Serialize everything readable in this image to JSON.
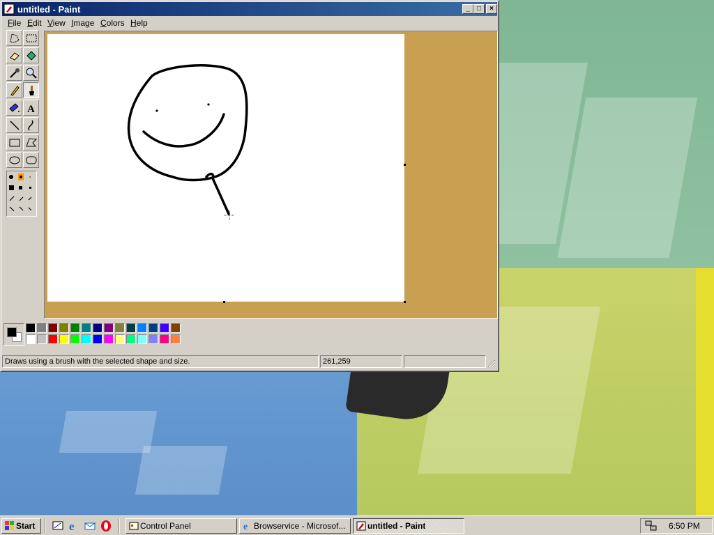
{
  "window": {
    "title": "untitled - Paint",
    "controls": {
      "minimize": "_",
      "maximize": "□",
      "close": "×"
    }
  },
  "menu": [
    {
      "label": "File",
      "accel": "F"
    },
    {
      "label": "Edit",
      "accel": "E"
    },
    {
      "label": "View",
      "accel": "V"
    },
    {
      "label": "Image",
      "accel": "I"
    },
    {
      "label": "Colors",
      "accel": "C"
    },
    {
      "label": "Help",
      "accel": "H"
    }
  ],
  "tools": [
    "free-form-select-icon",
    "select-icon",
    "eraser-icon",
    "fill-icon",
    "pick-color-icon",
    "magnifier-icon",
    "pencil-icon",
    "brush-icon",
    "airbrush-icon",
    "text-icon",
    "line-icon",
    "curve-icon",
    "rectangle-icon",
    "polygon-icon",
    "ellipse-icon",
    "rounded-rectangle-icon"
  ],
  "selected_tool": "brush-icon",
  "text_tool_glyph": "A",
  "colors": {
    "foreground": "#000000",
    "background": "#ffffff",
    "canvas_bg": "#c9a052",
    "palette_top": [
      "#000000",
      "#808080",
      "#800000",
      "#808000",
      "#008000",
      "#008080",
      "#000080",
      "#800080",
      "#808040",
      "#004040",
      "#0080ff",
      "#004080",
      "#4000ff",
      "#804000"
    ],
    "palette_bottom": [
      "#ffffff",
      "#c0c0c0",
      "#ff0000",
      "#ffff00",
      "#00ff00",
      "#00ffff",
      "#0000ff",
      "#ff00ff",
      "#ffff80",
      "#00ff80",
      "#80ffff",
      "#8080ff",
      "#ff0080",
      "#ff8040"
    ]
  },
  "status": {
    "help_text": "Draws using a brush with the selected shape and size.",
    "coords": "261,259",
    "size": ""
  },
  "taskbar": {
    "start_label": "Start",
    "quick_launch": [
      "show-desktop-icon",
      "internet-explorer-icon",
      "outlook-express-icon",
      "opera-icon"
    ],
    "tasks": [
      {
        "label": "Control Panel",
        "active": false,
        "icon": "control-panel-icon"
      },
      {
        "label": "Browservice - Microsof...",
        "active": false,
        "icon": "internet-explorer-icon"
      },
      {
        "label": "untitled - Paint",
        "active": true,
        "icon": "paint-icon"
      }
    ],
    "clock": "6:50 PM",
    "tray_icons": [
      "network-icon"
    ]
  }
}
